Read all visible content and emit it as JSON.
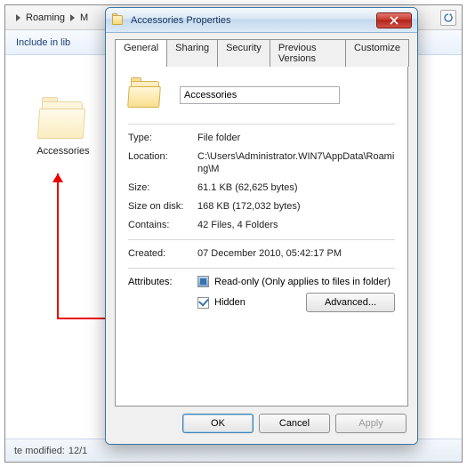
{
  "explorer": {
    "crumb1": "Roaming",
    "crumb2": "M",
    "toolbar_include": "Include in lib",
    "folder_name": "Accessories",
    "status_modified_label": "te modified:",
    "status_modified_value": "12/1"
  },
  "dialog": {
    "title": "Accessories Properties",
    "tabs": {
      "general": "General",
      "sharing": "Sharing",
      "security": "Security",
      "previous": "Previous Versions",
      "customize": "Customize"
    },
    "name_value": "Accessories",
    "rows": {
      "type_k": "Type:",
      "type_v": "File folder",
      "loc_k": "Location:",
      "loc_v": "C:\\Users\\Administrator.WIN7\\AppData\\Roaming\\M",
      "size_k": "Size:",
      "size_v": "61.1 KB (62,625 bytes)",
      "disk_k": "Size on disk:",
      "disk_v": "168 KB (172,032 bytes)",
      "cont_k": "Contains:",
      "cont_v": "42 Files, 4 Folders",
      "created_k": "Created:",
      "created_v": "07 December 2010, 05:42:17 PM",
      "attr_k": "Attributes:",
      "readonly": "Read-only (Only applies to files in folder)",
      "hidden": "Hidden",
      "advanced": "Advanced..."
    },
    "buttons": {
      "ok": "OK",
      "cancel": "Cancel",
      "apply": "Apply"
    }
  }
}
